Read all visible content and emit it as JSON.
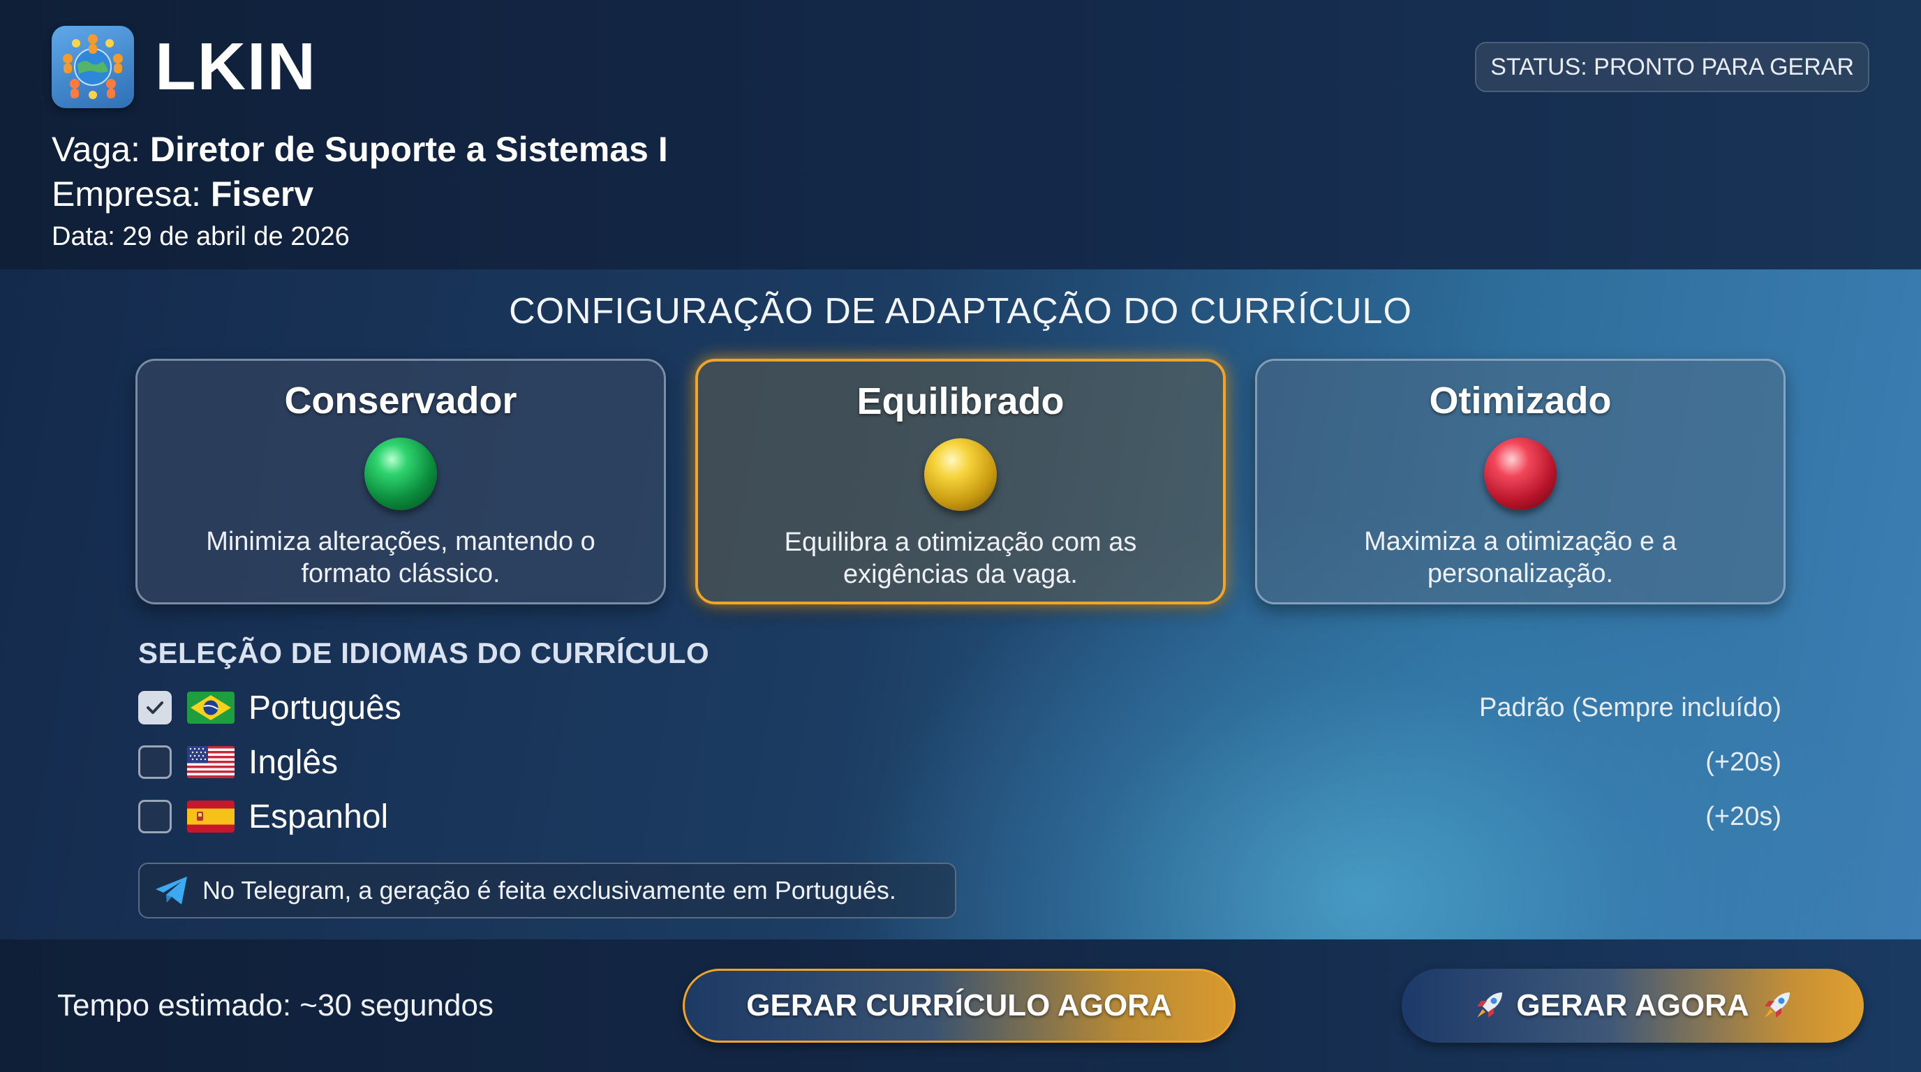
{
  "app": {
    "name": "LKIN",
    "logo_icon": "people-circle-globe-icon",
    "status": "STATUS: PRONTO PARA GERAR"
  },
  "job": {
    "vaga_label": "Vaga:",
    "vaga_value": "Diretor de Suporte a Sistemas I",
    "empresa_label": "Empresa:",
    "empresa_value": "Fiserv",
    "date": "Data: 29 de abril de 2026"
  },
  "adaptation": {
    "title": "CONFIGURAÇÃO DE ADAPTAÇÃO DO CURRÍCULO",
    "selected": "Equilibrado",
    "options": [
      {
        "title": "Conservador",
        "description": "Minimiza alterações, mantendo o formato clássico.",
        "indicator": "green-orb",
        "color": "#0b8a3c"
      },
      {
        "title": "Equilibrado",
        "description": "Equilibra a otimização com as exigências da vaga.",
        "indicator": "yellow-orb",
        "color": "#f6d43c"
      },
      {
        "title": "Otimizado",
        "description": "Maximiza a otimização e a personalização.",
        "indicator": "red-orb",
        "color": "#b8142a"
      }
    ]
  },
  "languages": {
    "title": "SELEÇÃO DE IDIOMAS DO CURRÍCULO",
    "items": [
      {
        "name": "Português",
        "note": "Padrão (Sempre incluído)",
        "checked": true,
        "flag": "brazil-flag-icon"
      },
      {
        "name": "Inglês",
        "note": "(+20s)",
        "checked": false,
        "flag": "usa-flag-icon"
      },
      {
        "name": "Espanhol",
        "note": "(+20s)",
        "checked": false,
        "flag": "spain-flag-icon"
      }
    ]
  },
  "telegram_note": {
    "icon": "telegram-icon",
    "text": "No Telegram, a geração é feita exclusivamente em Português."
  },
  "footer": {
    "estimate": "Tempo estimado: ~30 segundos",
    "primary_button": "GERAR CURRÍCULO AGORA",
    "secondary_button": "GERAR AGORA",
    "secondary_icon": "rocket-icon"
  },
  "colors": {
    "accent": "#f0a52a",
    "background": "#14284a"
  }
}
